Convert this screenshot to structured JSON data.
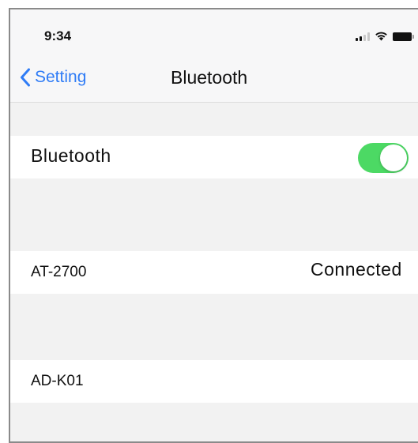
{
  "status_bar": {
    "time": "9:34",
    "icons": [
      "signal-icon",
      "wifi-icon",
      "battery-icon"
    ]
  },
  "nav": {
    "back_label": "Setting",
    "back_icon": "chevron-left-icon",
    "title": "Bluetooth"
  },
  "bluetooth": {
    "label": "Bluetooth",
    "toggle_on": true,
    "toggle_color": "#4cd964"
  },
  "devices": [
    {
      "name": "AT-2700",
      "status": "Connected"
    },
    {
      "name": "AD-K01",
      "status": ""
    }
  ],
  "colors": {
    "accent": "#2f7cf6",
    "group_background": "#f2f2f2",
    "row_background": "#ffffff"
  }
}
